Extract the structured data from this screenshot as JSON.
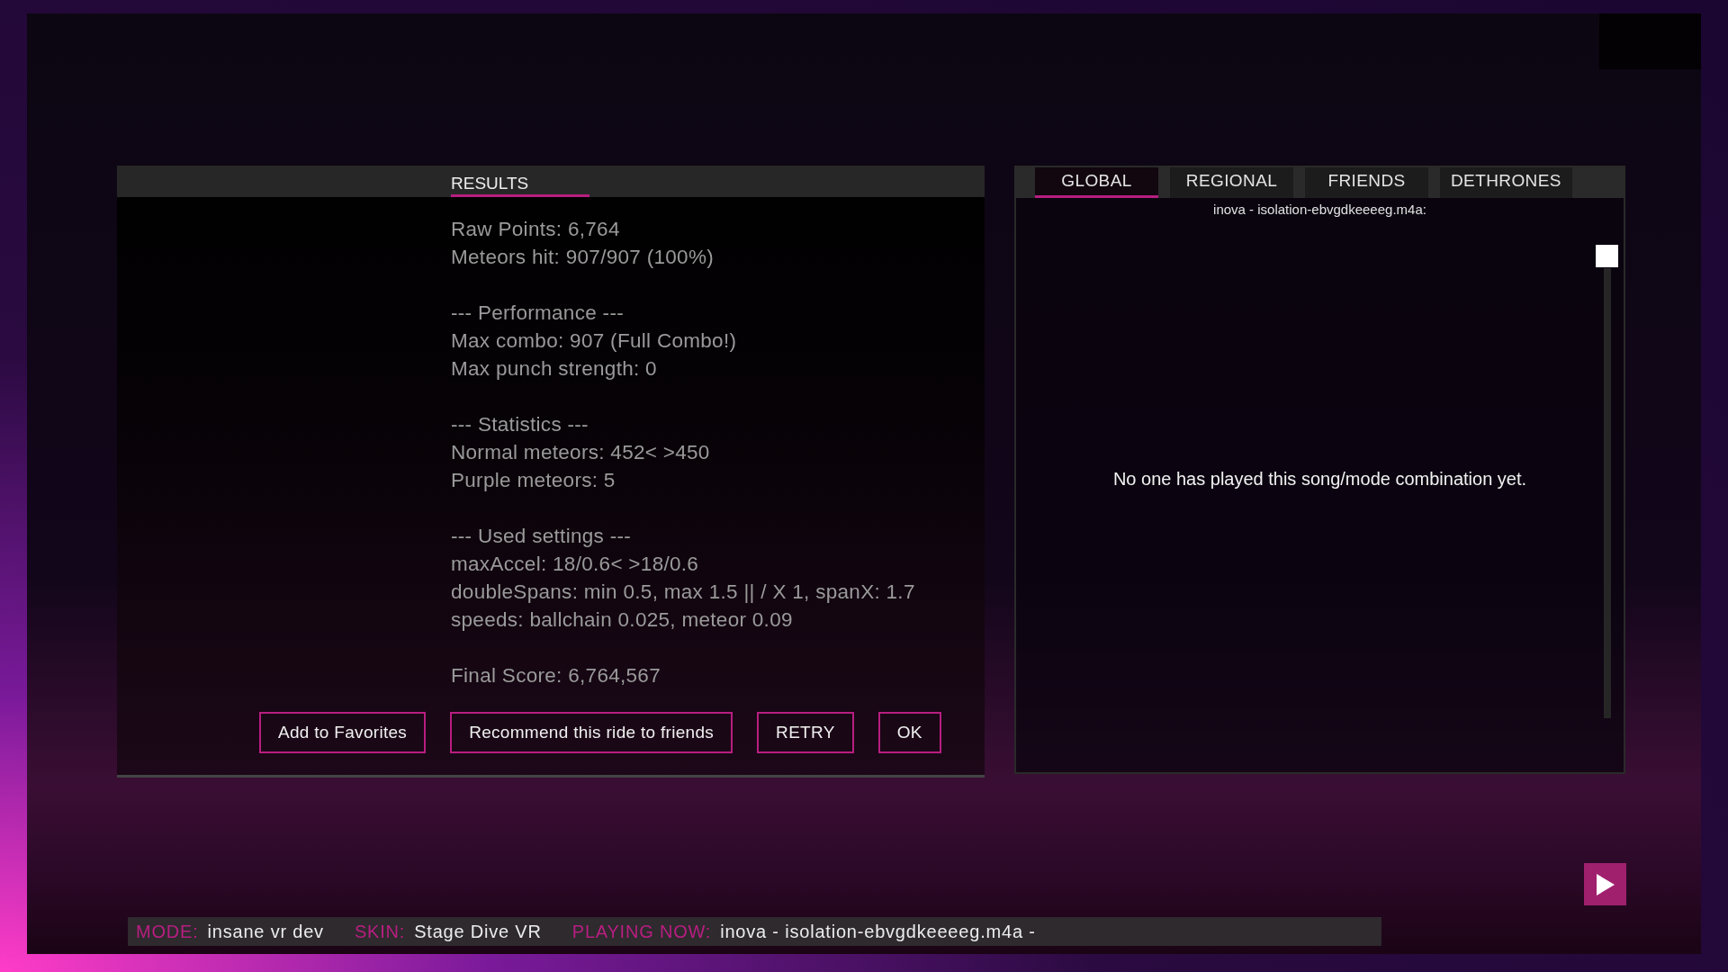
{
  "results_panel": {
    "tabs": [
      {
        "label": "RESULTS",
        "selected": true
      }
    ],
    "sections": [
      [
        "Raw Points: 6,764",
        "Meteors hit: 907/907 (100%)"
      ],
      [
        "--- Performance ---",
        "Max combo: 907 (Full Combo!)",
        "Max punch strength: 0"
      ],
      [
        "--- Statistics ---",
        "Normal meteors: 452< >450",
        "Purple meteors: 5"
      ],
      [
        "--- Used settings ---",
        "maxAccel: 18/0.6< >18/0.6",
        "doubleSpans: min 0.5, max 1.5 || / X 1, spanX: 1.7",
        "speeds: ballchain 0.025, meteor 0.09"
      ],
      [
        "Final Score: 6,764,567"
      ]
    ],
    "buttons": [
      "Add to Favorites",
      "Recommend this ride to friends",
      "RETRY",
      "OK"
    ]
  },
  "leaderboard": {
    "tabs": [
      {
        "label": "GLOBAL",
        "selected": true
      },
      {
        "label": "REGIONAL",
        "selected": false
      },
      {
        "label": "FRIENDS",
        "selected": false
      },
      {
        "label": "DETHRONES",
        "selected": false
      }
    ],
    "song": "inova - isolation-ebvgdkeeeeg.m4a:",
    "message": "No one has played this song/mode combination yet."
  },
  "status_bar": [
    {
      "label": "MODE:",
      "value": "insane vr dev"
    },
    {
      "label": "SKIN:",
      "value": "Stage Dive VR"
    },
    {
      "label": "PLAYING NOW:",
      "value": "inova - isolation-ebvgdkeeeeg.m4a -"
    }
  ]
}
